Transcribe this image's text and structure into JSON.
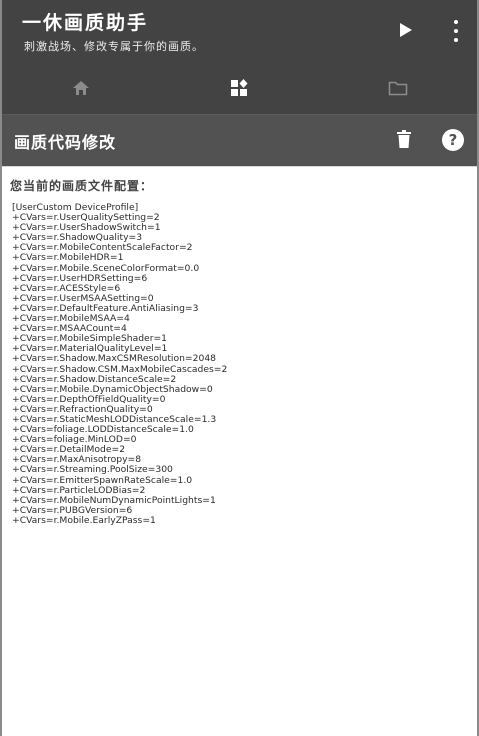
{
  "app": {
    "title": "一休画质助手",
    "subtitle": "刺激战场、修改专属于你的画质。"
  },
  "header": {
    "play_icon": "play-icon",
    "more_icon": "more-vert-icon"
  },
  "tabs": [
    {
      "icon": "home-icon",
      "selected": false
    },
    {
      "icon": "widgets-icon",
      "selected": true
    },
    {
      "icon": "folder-icon",
      "selected": false
    }
  ],
  "section": {
    "title": "画质代码修改",
    "delete_icon": "trash-icon",
    "help_label": "?"
  },
  "content": {
    "label": "您当前的画质文件配置：",
    "config_text": "[UserCustom DeviceProfile]\n+CVars=r.UserQualitySetting=2\n+CVars=r.UserShadowSwitch=1\n+CVars=r.ShadowQuality=3\n+CVars=r.MobileContentScaleFactor=2\n+CVars=r.MobileHDR=1\n+CVars=r.Mobile.SceneColorFormat=0.0\n+CVars=r.UserHDRSetting=6\n+CVars=r.ACESStyle=6\n+CVars=r.UserMSAASetting=0\n+CVars=r.DefaultFeature.AntiAliasing=3\n+CVars=r.MobileMSAA=4\n+CVars=r.MSAACount=4\n+CVars=r.MobileSimpleShader=1\n+CVars=r.MaterialQualityLevel=1\n+CVars=r.Shadow.MaxCSMResolution=2048\n+CVars=r.Shadow.CSM.MaxMobileCascades=2\n+CVars=r.Shadow.DistanceScale=2\n+CVars=r.Mobile.DynamicObjectShadow=0\n+CVars=r.DepthOfFieldQuality=0\n+CVars=r.RefractionQuality=0\n+CVars=r.StaticMeshLODDistanceScale=1.3\n+CVars=foliage.LODDistanceScale=1.0\n+CVars=foliage.MinLOD=0\n+CVars=r.DetailMode=2\n+CVars=r.MaxAnisotropy=8\n+CVars=r.Streaming.PoolSize=300\n+CVars=r.EmitterSpawnRateScale=1.0\n+CVars=r.ParticleLODBias=2\n+CVars=r.MobileNumDynamicPointLights=1\n+CVars=r.PUBGVersion=6\n+CVars=r.Mobile.EarlyZPass=1"
  },
  "colors": {
    "appbar": "#434343",
    "section_bar": "#525252",
    "tab_icon_inactive": "#8c8c8c",
    "tab_icon_active": "#ffffff"
  }
}
